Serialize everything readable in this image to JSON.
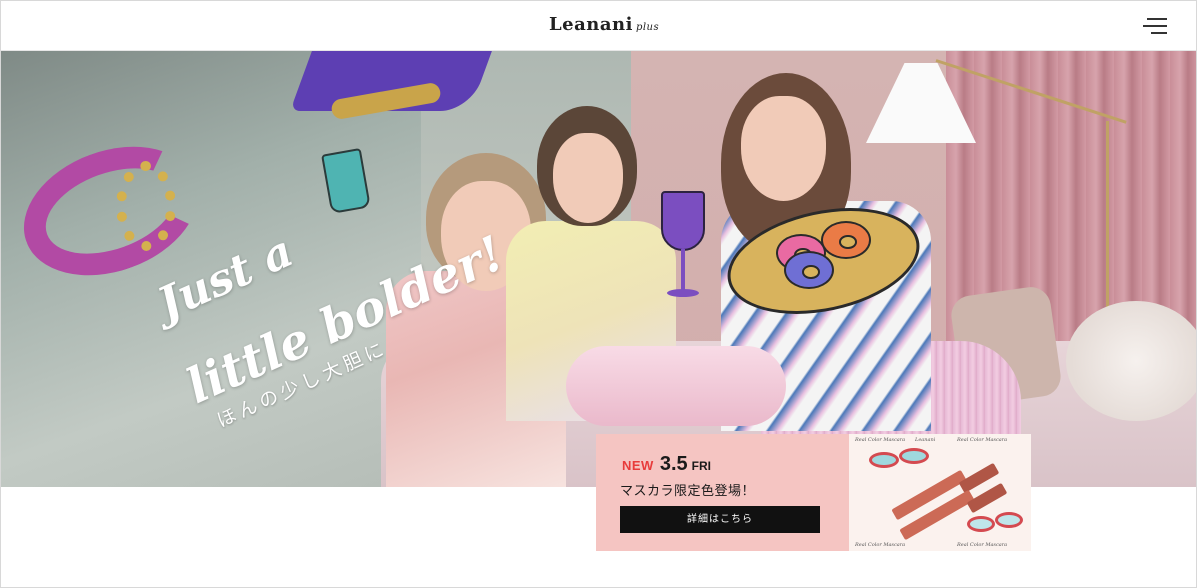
{
  "header": {
    "logo_main": "Leanani",
    "logo_sub": "plus"
  },
  "hero": {
    "script_line1": "Just a",
    "script_line2": "little bolder!",
    "script_jp": "ほんの少し大胆に"
  },
  "news": {
    "new_label": "NEW",
    "date": "3.5",
    "day_of_week": "FRI",
    "title": "マスカラ限定色登場！",
    "button_label": "詳細はこちら"
  },
  "product": {
    "label": "Real Color Mascara",
    "brand": "Leanani"
  },
  "colors": {
    "accent_red": "#e83b3b",
    "banner_pink": "#f5c5c2",
    "button_black": "#111111"
  }
}
